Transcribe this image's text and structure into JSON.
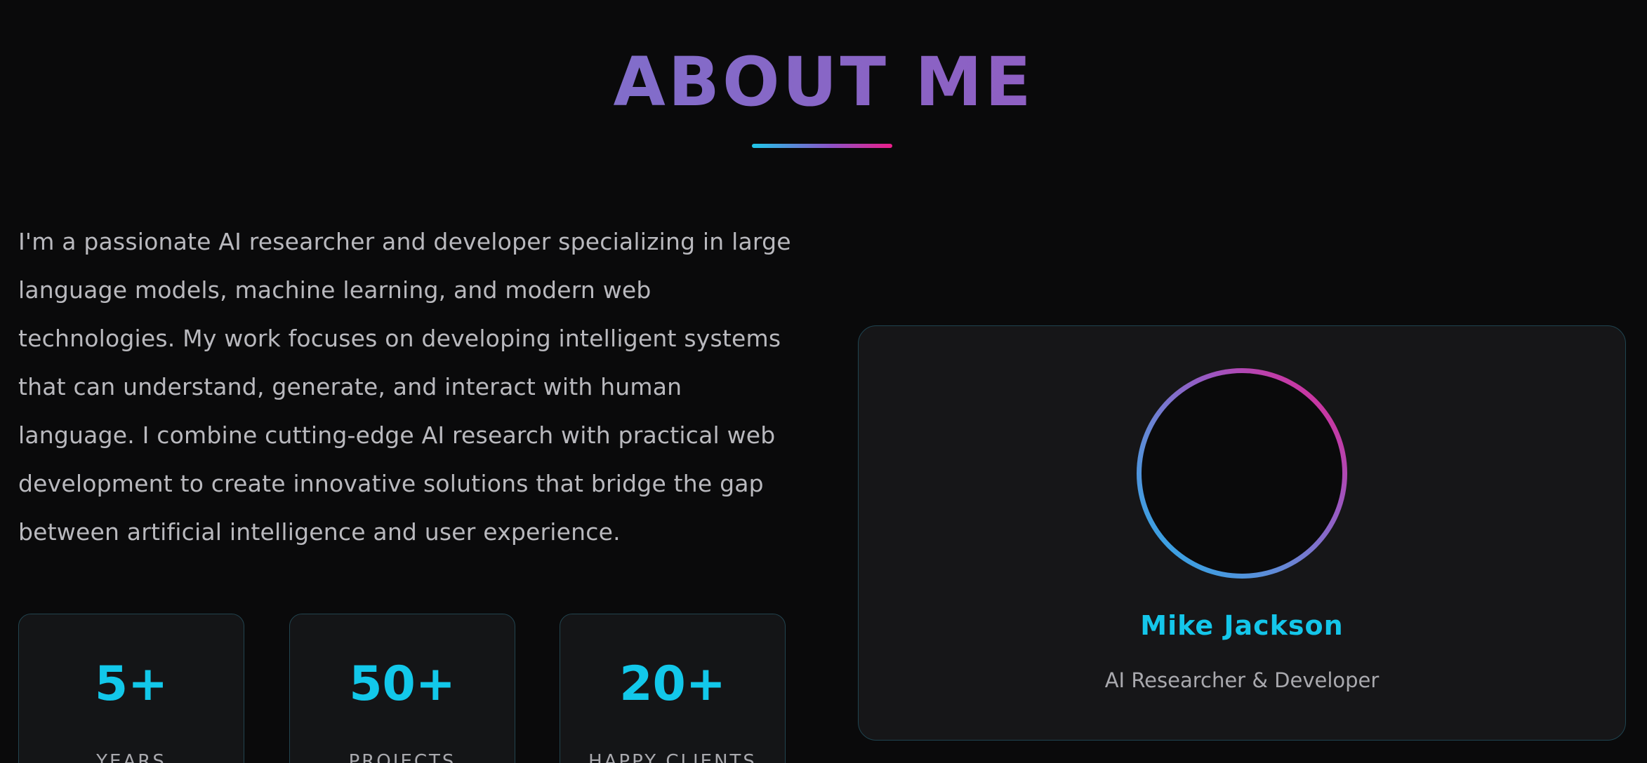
{
  "section": {
    "title": "ABOUT ME"
  },
  "bio": {
    "text": "I'm a passionate AI researcher and developer specializing in large language models, machine learning, and modern web technologies. My work focuses on developing intelligent systems that can understand, generate, and interact with human language. I combine cutting-edge AI research with practical web development to create innovative solutions that bridge the gap between artificial intelligence and user experience."
  },
  "stats": [
    {
      "value": "5+",
      "label": "YEARS"
    },
    {
      "value": "50+",
      "label": "PROJECTS"
    },
    {
      "value": "20+",
      "label": "HAPPY CLIENTS"
    }
  ],
  "profile": {
    "name": "Mike Jackson",
    "role": "AI Researcher & Developer"
  },
  "colors": {
    "background": "#0a0a0b",
    "accent_cyan": "#12c8ea",
    "accent_pink": "#ec1e8a",
    "accent_purple": "#8a63c4"
  }
}
